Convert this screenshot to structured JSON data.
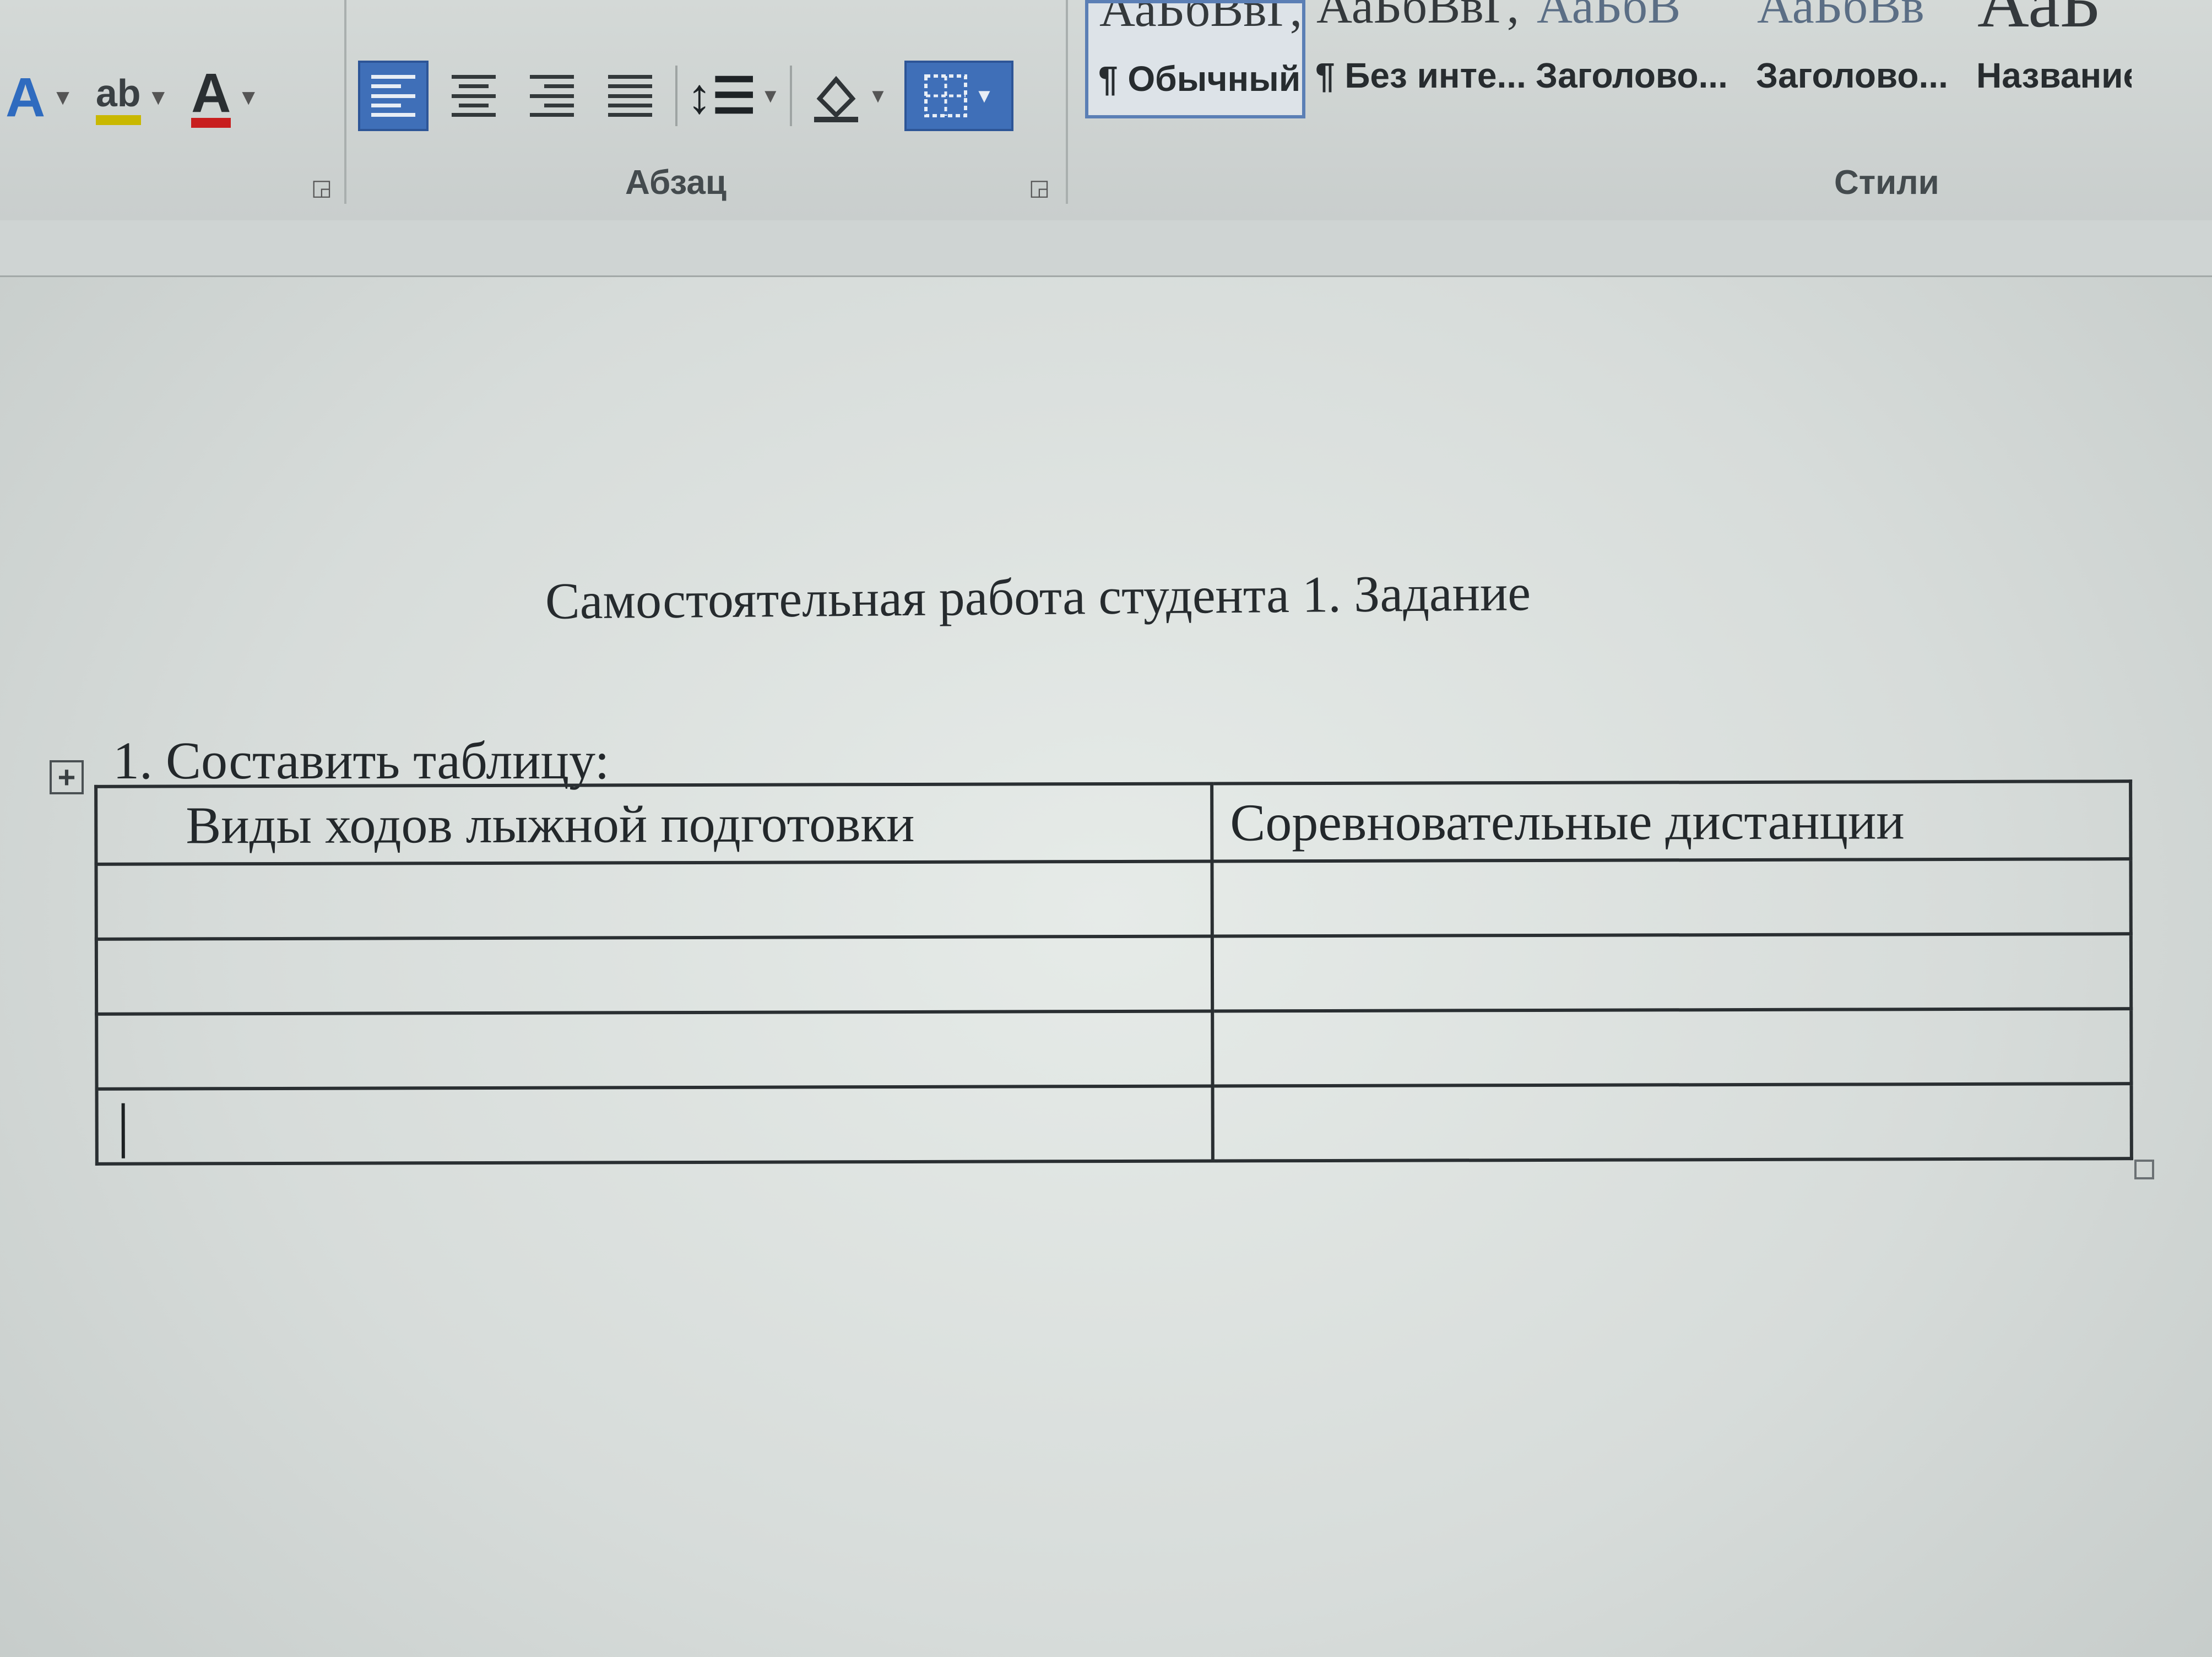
{
  "ribbon": {
    "font_group": {
      "buttons": [
        {
          "name": "text-effects-button",
          "glyph": "A",
          "color": "#2f6bbf"
        },
        {
          "name": "highlight-color-button",
          "glyph": "ab",
          "color": "#c9b800"
        },
        {
          "name": "font-color-button",
          "glyph": "A",
          "color": "#c81e1e"
        }
      ]
    },
    "paragraph_group": {
      "label": "Абзац",
      "align_left_active": true
    },
    "styles_group": {
      "label": "Стили",
      "items": [
        {
          "preview": "АаБбВвГ,",
          "name": "¶ Обычный",
          "selected": true
        },
        {
          "preview": "АаБбВвГ,",
          "name": "¶ Без инте..."
        },
        {
          "preview": "АаБбВ",
          "name": "Заголово..."
        },
        {
          "preview": "АаБбВв",
          "name": "Заголово..."
        },
        {
          "preview": "АаБ",
          "name": "Название"
        }
      ]
    }
  },
  "document": {
    "title": "Самостоятельная работа студента 1. Задание",
    "task": "1. Составить таблицу:",
    "table": {
      "headers": [
        "Виды ходов лыжной подготовки",
        "Соревновательные дистанции"
      ],
      "rows": [
        [
          "",
          ""
        ],
        [
          "",
          ""
        ],
        [
          "",
          ""
        ],
        [
          "",
          ""
        ]
      ]
    }
  }
}
